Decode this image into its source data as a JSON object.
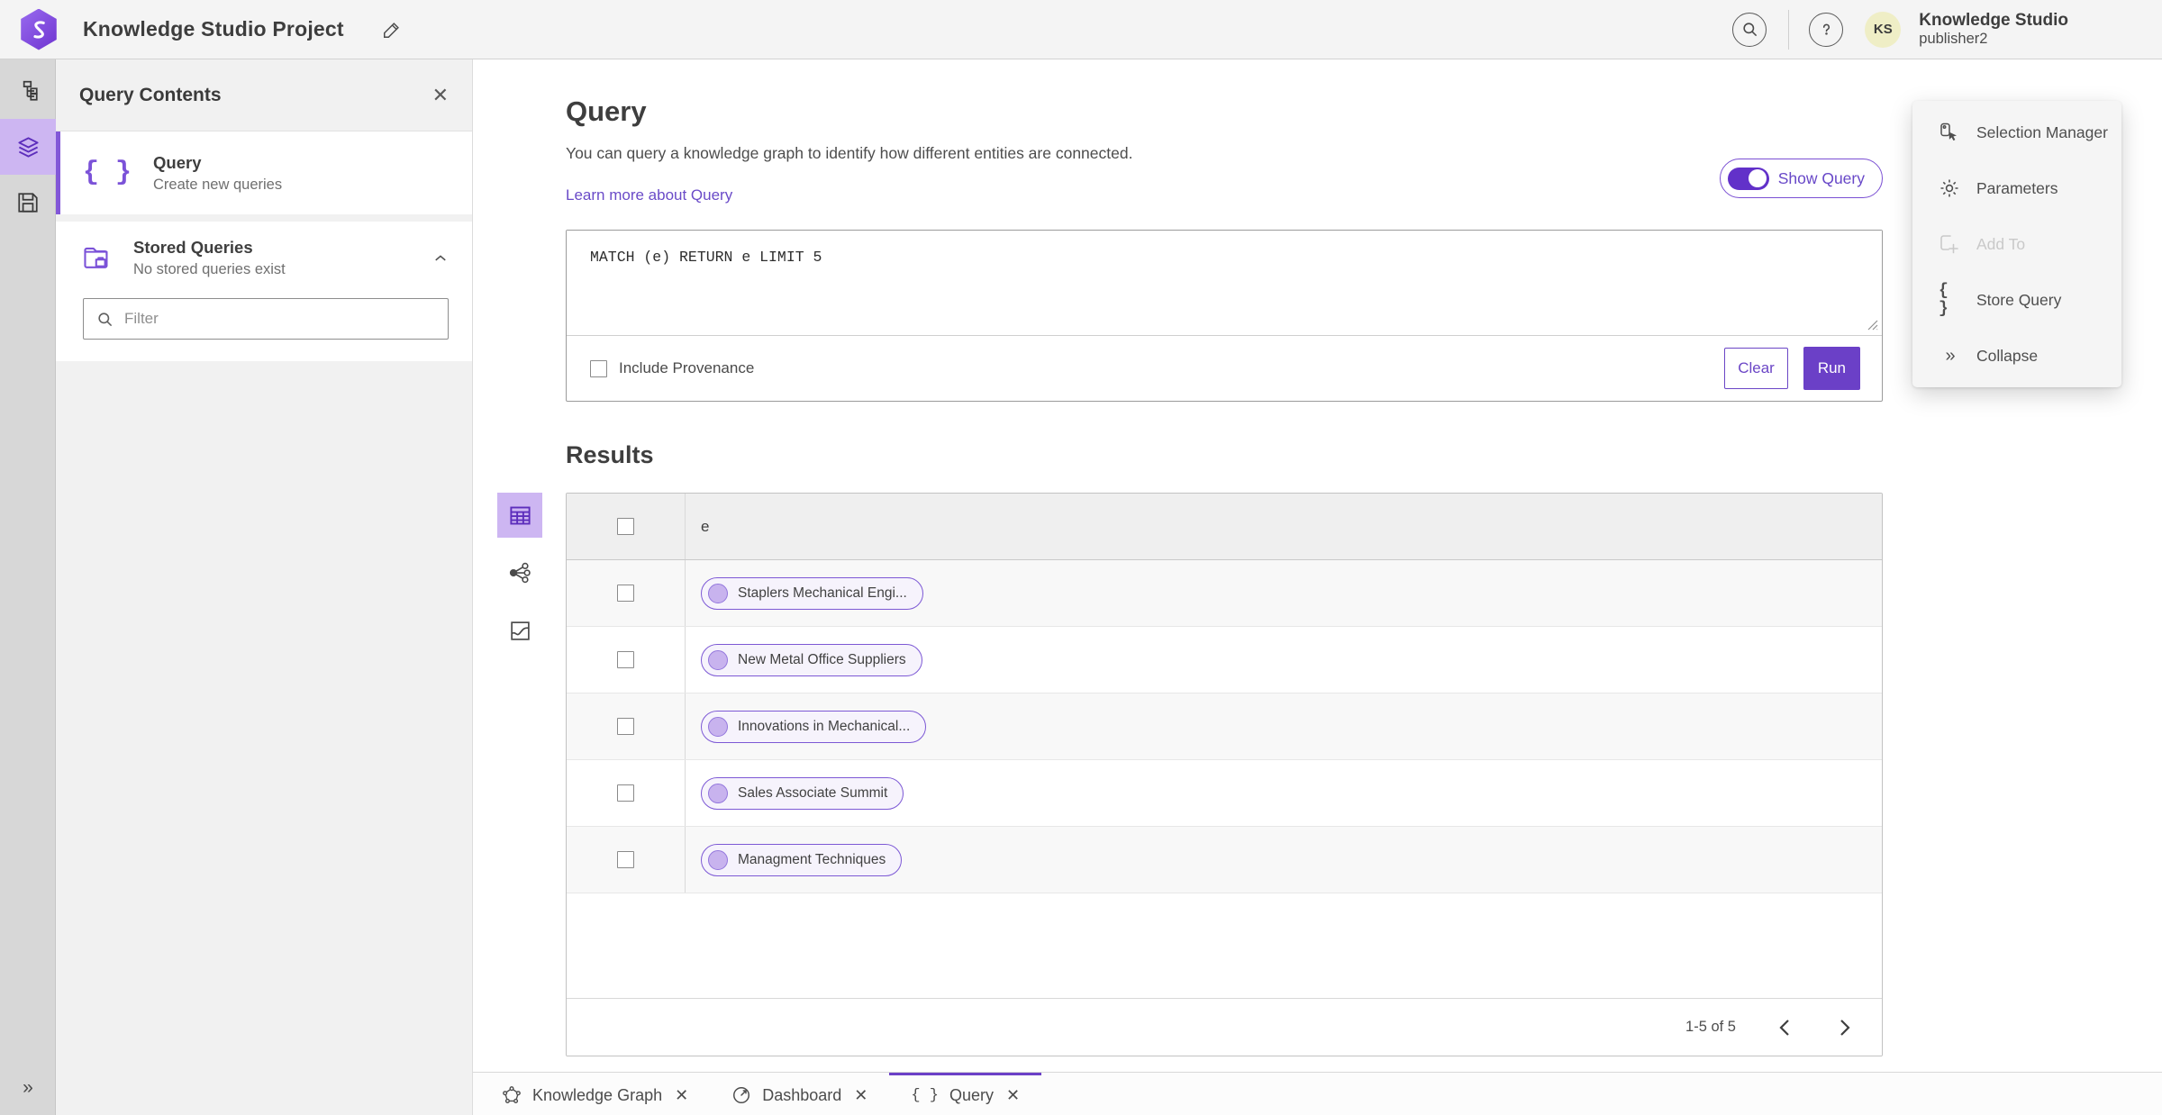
{
  "colors": {
    "accent": "#6b40c7",
    "accent_light": "#cdb6f2",
    "link": "#6a4bc8"
  },
  "topbar": {
    "title": "Knowledge Studio Project",
    "org_name": "Knowledge Studio",
    "user_name": "publisher2",
    "avatar_initials": "KS"
  },
  "sidebar_panel": {
    "title": "Query Contents",
    "query_item": {
      "title": "Query",
      "subtitle": "Create new queries"
    },
    "stored_item": {
      "title": "Stored Queries",
      "subtitle": "No stored queries exist"
    },
    "filter_placeholder": "Filter"
  },
  "query_section": {
    "heading": "Query",
    "description": "You can query a knowledge graph to identify how different entities are connected.",
    "learn_more_label": "Learn more about Query",
    "show_query_label": "Show Query",
    "query_text": "MATCH (e) RETURN e LIMIT 5",
    "include_provenance_label": "Include Provenance",
    "clear_label": "Clear",
    "run_label": "Run"
  },
  "results_section": {
    "heading": "Results",
    "column_header": "e",
    "rows": [
      "Staplers Mechanical Engi...",
      "New Metal Office Suppliers",
      "Innovations in Mechanical...",
      "Sales Associate Summit",
      "Managment Techniques"
    ],
    "pagination_label": "1-5 of 5"
  },
  "context_menu": {
    "items": [
      {
        "label": "Selection Manager"
      },
      {
        "label": "Parameters"
      },
      {
        "label": "Add To",
        "disabled": true
      },
      {
        "label": "Store Query"
      },
      {
        "label": "Collapse"
      }
    ]
  },
  "bottom_tabs": [
    {
      "label": "Knowledge Graph"
    },
    {
      "label": "Dashboard"
    },
    {
      "label": "Query",
      "active": true
    }
  ]
}
